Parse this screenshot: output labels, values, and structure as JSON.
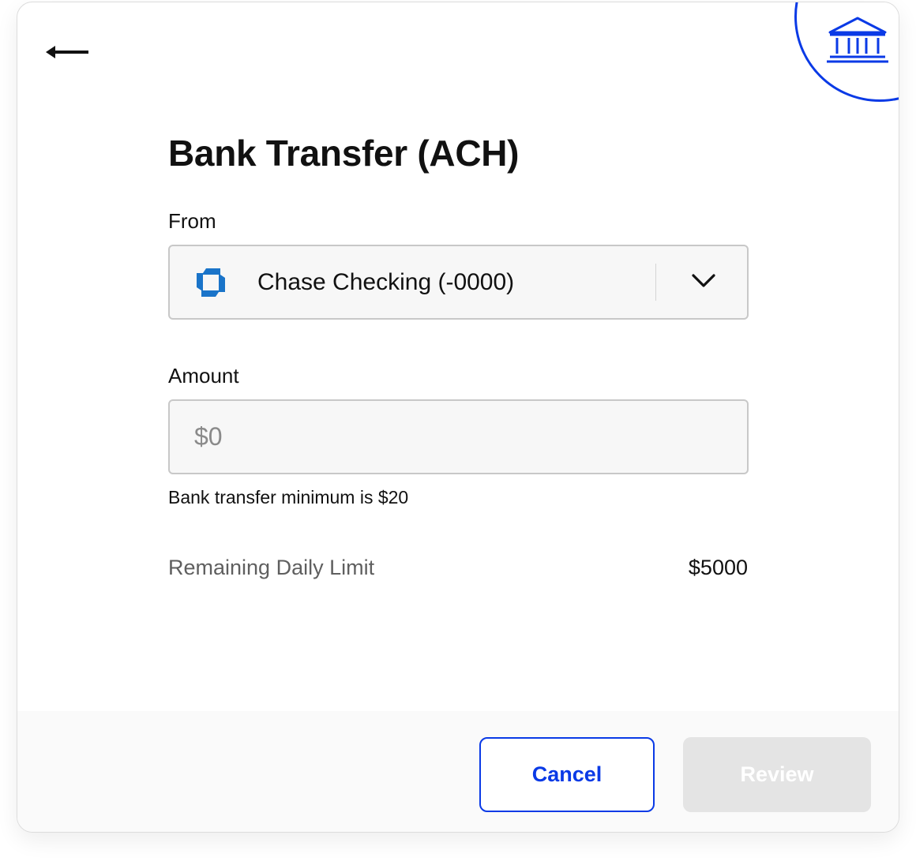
{
  "title": "Bank Transfer (ACH)",
  "from": {
    "label": "From",
    "selected_account": "Chase Checking (-0000)",
    "bank_icon": "chase-octagon-logo"
  },
  "amount": {
    "label": "Amount",
    "placeholder": "$0",
    "value": "",
    "hint": "Bank transfer minimum is $20"
  },
  "limit": {
    "label": "Remaining Daily Limit",
    "value": "$5000"
  },
  "actions": {
    "cancel_label": "Cancel",
    "review_label": "Review",
    "review_enabled": false
  },
  "icons": {
    "back": "left-arrow-icon",
    "header": "bank-building-icon",
    "dropdown": "chevron-down-icon"
  },
  "colors": {
    "accent": "#0a3ae6",
    "chase_blue": "#1a74c9",
    "disabled_bg": "#e4e4e4"
  }
}
